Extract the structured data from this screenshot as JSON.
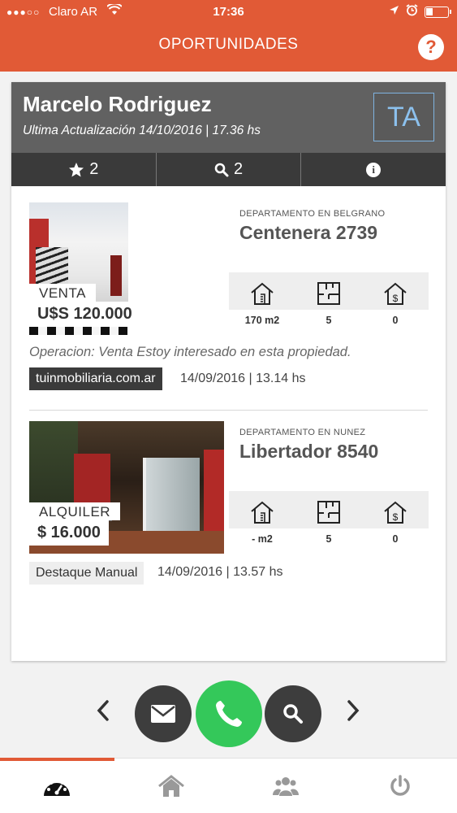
{
  "status": {
    "carrier": "Claro AR",
    "time": "17:36"
  },
  "header": {
    "title": "OPORTUNIDADES",
    "help": "?"
  },
  "client": {
    "name": "Marcelo Rodriguez",
    "updated": "Ultima Actualización 14/10/2016 | 17.36 hs",
    "initials": "TA",
    "stats": {
      "favorites": "2",
      "searches": "2"
    }
  },
  "listings": [
    {
      "type": "VENTA",
      "price": "U$S 120.000",
      "category": "DEPARTAMENTO EN BELGRANO",
      "address": "Centenera 2739",
      "area": "170 m2",
      "rooms": "5",
      "expenses": "0",
      "operation": "Operacion: Venta Estoy interesado en esta propiedad.",
      "source": "tuinmobiliaria.com.ar",
      "date": "14/09/2016 | 13.14 hs"
    },
    {
      "type": "ALQUILER",
      "price": "$ 16.000",
      "category": "DEPARTAMENTO EN NUNEZ",
      "address": "Libertador 8540",
      "area": "- m2",
      "rooms": "5",
      "expenses": "0",
      "source": "Destaque Manual",
      "date": "14/09/2016 | 13.57 hs"
    }
  ],
  "colors": {
    "accent": "#e15a36",
    "dark": "#3a3a3a",
    "call": "#34c85a"
  },
  "icons": [
    "star-icon",
    "search-icon",
    "info-icon",
    "house-area-icon",
    "floorplan-icon",
    "house-dollar-icon",
    "mail-icon",
    "phone-icon",
    "dashboard-icon",
    "home-icon",
    "users-icon",
    "power-icon"
  ]
}
